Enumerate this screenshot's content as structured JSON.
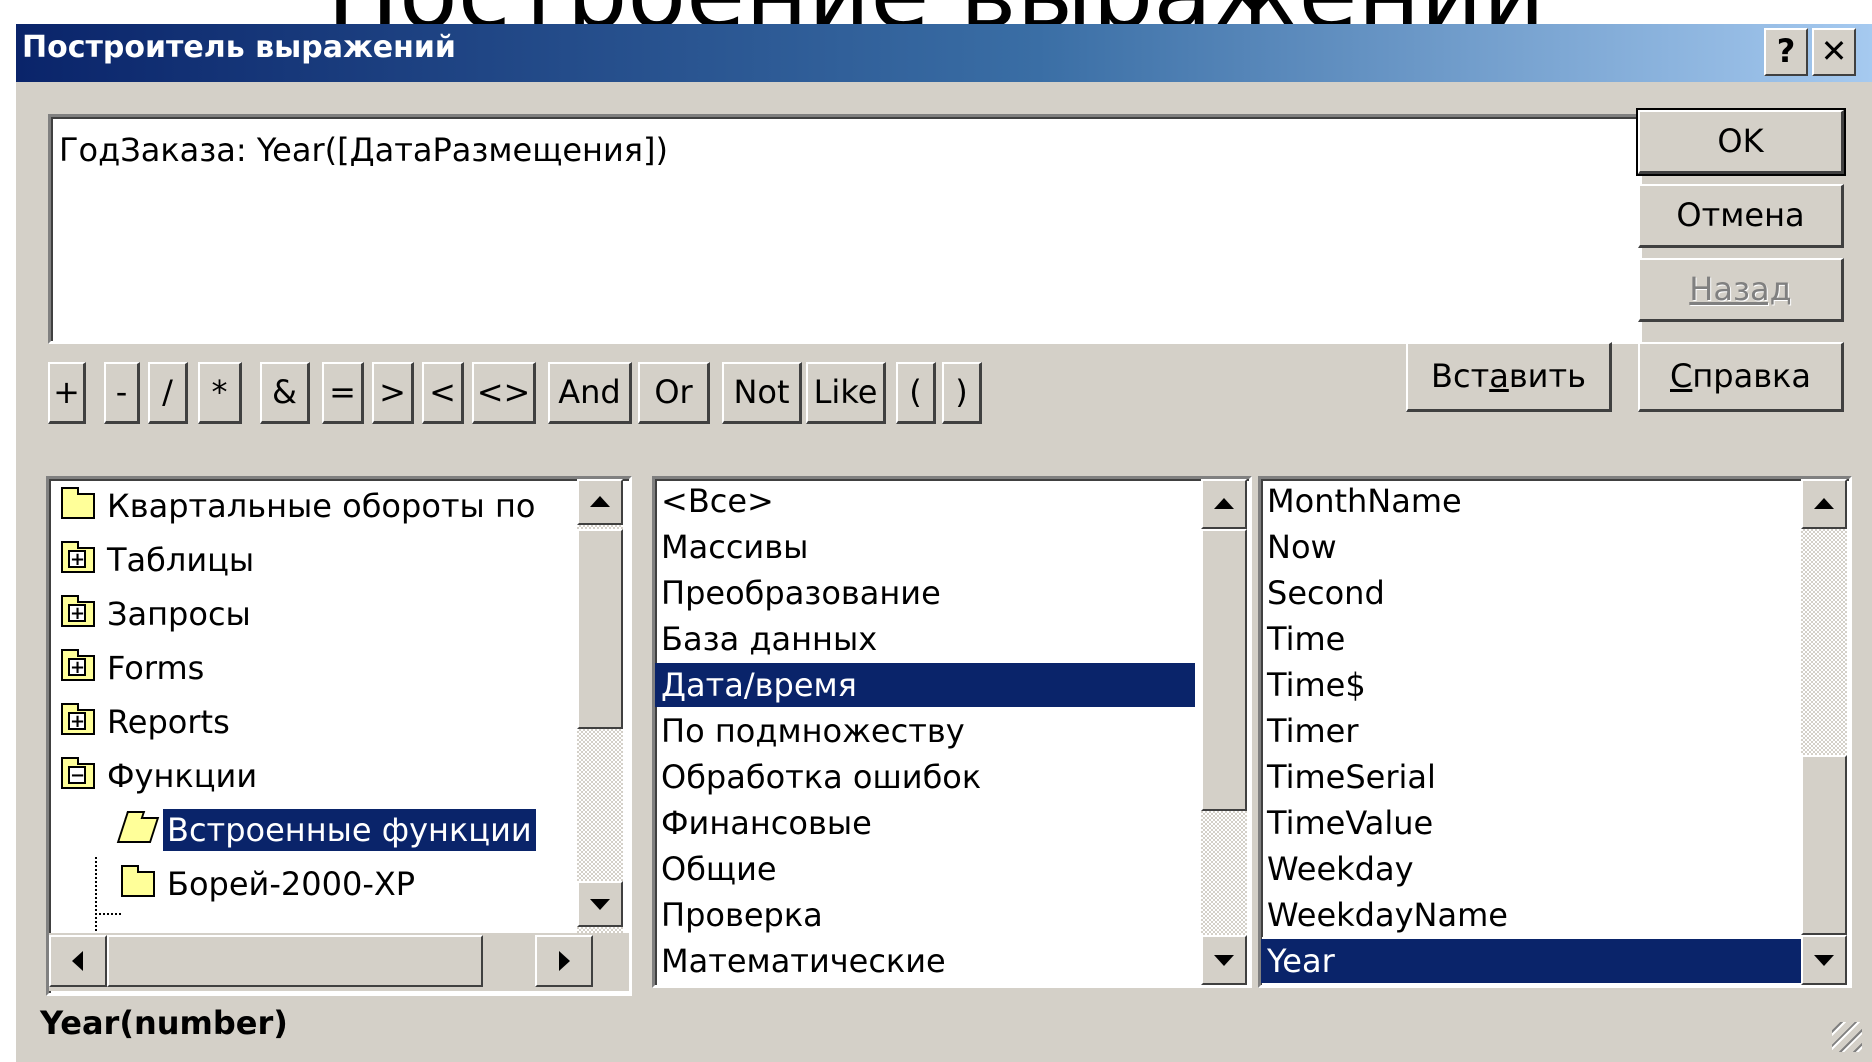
{
  "slide_title": "Построение выражений",
  "dialog": {
    "title": "Построитель выражений",
    "help_btn": "?",
    "close_btn": "✕"
  },
  "expression": "ГодЗаказа: Year([ДатаРазмещения])",
  "buttons": {
    "ok": "OK",
    "cancel": "Отмена",
    "back": "Назад",
    "paste_pre": "Вст",
    "paste_u": "а",
    "paste_post": "вить",
    "help_u": "С",
    "help_post": "правка"
  },
  "operators": [
    "+",
    "-",
    "/",
    "*",
    "&",
    "=",
    ">",
    "<",
    "<>",
    "And",
    "Or",
    "Not",
    "Like",
    "(",
    ")"
  ],
  "tree": [
    {
      "label": "Квартальные обороты по",
      "icon": "folder-icon",
      "expander": ""
    },
    {
      "label": "Таблицы",
      "icon": "folder-icon",
      "expander": "+"
    },
    {
      "label": "Запросы",
      "icon": "folder-icon",
      "expander": "+"
    },
    {
      "label": "Forms",
      "icon": "folder-icon",
      "expander": "+"
    },
    {
      "label": "Reports",
      "icon": "folder-icon",
      "expander": "+"
    },
    {
      "label": "Функции",
      "icon": "folder-icon",
      "expander": "−"
    },
    {
      "label": "Встроенные функции",
      "icon": "open-folder-icon",
      "expander": "",
      "selected": true
    },
    {
      "label": "Борей-2000-XP",
      "icon": "folder-icon",
      "expander": ""
    }
  ],
  "categories": [
    "<Все>",
    "Массивы",
    "Преобразование",
    "База данных",
    "Дата/время",
    "По подмножеству",
    "Обработка ошибок",
    "Финансовые",
    "Общие",
    "Проверка",
    "Математические"
  ],
  "categories_selected": 4,
  "functions": [
    "MonthName",
    "Now",
    "Second",
    "Time",
    "Time$",
    "Timer",
    "TimeSerial",
    "TimeValue",
    "Weekday",
    "WeekdayName",
    "Year"
  ],
  "functions_selected": 10,
  "footer": "Year(number)",
  "colors": {
    "titlebar_start": "#0a246a",
    "face": "#d4d0c8",
    "selection": "#0a246a"
  }
}
